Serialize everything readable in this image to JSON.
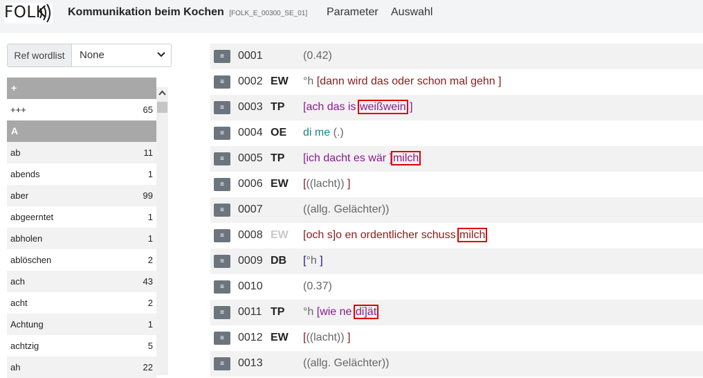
{
  "header": {
    "logo_text": "FOLK",
    "title": "Kommunikation beim Kochen",
    "transcript_id": "[FOLK_E_00300_SE_01]",
    "nav": [
      "Parameter",
      "Auswahl"
    ]
  },
  "sidebar": {
    "ref_label": "Ref wordlist",
    "ref_value": "None",
    "words": [
      {
        "kind": "group",
        "label": "+"
      },
      {
        "kind": "word",
        "word": "+++",
        "count": "65"
      },
      {
        "kind": "group",
        "label": "A"
      },
      {
        "kind": "word",
        "word": "ab",
        "count": "11"
      },
      {
        "kind": "word",
        "word": "abends",
        "count": "1"
      },
      {
        "kind": "word",
        "word": "aber",
        "count": "99"
      },
      {
        "kind": "word",
        "word": "abgeerntet",
        "count": "1"
      },
      {
        "kind": "word",
        "word": "abholen",
        "count": "1"
      },
      {
        "kind": "word",
        "word": "ablöschen",
        "count": "2"
      },
      {
        "kind": "word",
        "word": "ach",
        "count": "43"
      },
      {
        "kind": "word",
        "word": "acht",
        "count": "2"
      },
      {
        "kind": "word",
        "word": "Achtung",
        "count": "1"
      },
      {
        "kind": "word",
        "word": "achtzig",
        "count": "5"
      },
      {
        "kind": "word",
        "word": "ah",
        "count": "22"
      }
    ]
  },
  "transcript": {
    "button_icon": "≡",
    "colors": {
      "gray": "#666666",
      "dark": "#8b1a1a",
      "purple": "#8b1a8b",
      "teal": "#1a8585",
      "navy": "#1a1a8b",
      "highlight": "#e00000"
    },
    "lines": [
      {
        "num": "0001",
        "speaker": "",
        "faded": false,
        "segments": [
          {
            "text": "(0.42)",
            "color": "gray"
          }
        ]
      },
      {
        "num": "0002",
        "speaker": "EW",
        "faded": false,
        "segments": [
          {
            "text": "°h ",
            "color": "gray"
          },
          {
            "text": "[dann wird das oder schon mal gehn ]",
            "color": "dark"
          }
        ]
      },
      {
        "num": "0003",
        "speaker": "TP",
        "faded": false,
        "segments": [
          {
            "text": "[ach das is ",
            "color": "purple"
          },
          {
            "text": "weißwein",
            "color": "purple",
            "hl": true
          },
          {
            "text": " ]",
            "color": "purple"
          }
        ]
      },
      {
        "num": "0004",
        "speaker": "OE",
        "faded": false,
        "segments": [
          {
            "text": "di me ",
            "color": "teal"
          },
          {
            "text": "(.)",
            "color": "gray"
          }
        ]
      },
      {
        "num": "0005",
        "speaker": "TP",
        "faded": false,
        "segments": [
          {
            "text": "[ich dacht es wär ]",
            "color": "purple"
          },
          {
            "text": "milch",
            "color": "purple",
            "hl": true
          }
        ]
      },
      {
        "num": "0006",
        "speaker": "EW",
        "faded": false,
        "segments": [
          {
            "text": "[",
            "color": "dark"
          },
          {
            "text": "((lacht))",
            "color": "gray"
          },
          {
            "text": " ]",
            "color": "dark"
          }
        ]
      },
      {
        "num": "0007",
        "speaker": "",
        "faded": false,
        "segments": [
          {
            "text": "((allg. Gelächter))",
            "color": "gray"
          }
        ]
      },
      {
        "num": "0008",
        "speaker": "EW",
        "faded": true,
        "segments": [
          {
            "text": "[och s]o en ordentlicher schuss ",
            "color": "dark"
          },
          {
            "text": "milch",
            "color": "dark",
            "hl": true
          }
        ]
      },
      {
        "num": "0009",
        "speaker": "DB",
        "faded": false,
        "segments": [
          {
            "text": "[",
            "color": "navy"
          },
          {
            "text": "°h",
            "color": "gray"
          },
          {
            "text": " ]",
            "color": "navy"
          }
        ]
      },
      {
        "num": "0010",
        "speaker": "",
        "faded": false,
        "segments": [
          {
            "text": "(0.37)",
            "color": "gray"
          }
        ]
      },
      {
        "num": "0011",
        "speaker": "TP",
        "faded": false,
        "segments": [
          {
            "text": "°h ",
            "color": "gray"
          },
          {
            "text": "[wie ne ",
            "color": "purple"
          },
          {
            "text": "di]ät",
            "color": "purple",
            "hl": true
          }
        ]
      },
      {
        "num": "0012",
        "speaker": "EW",
        "faded": false,
        "segments": [
          {
            "text": "[",
            "color": "dark"
          },
          {
            "text": "((lacht))",
            "color": "gray"
          },
          {
            "text": " ]",
            "color": "dark"
          }
        ]
      },
      {
        "num": "0013",
        "speaker": "",
        "faded": false,
        "segments": [
          {
            "text": "((allg. Gelächter))",
            "color": "gray"
          }
        ]
      }
    ]
  }
}
